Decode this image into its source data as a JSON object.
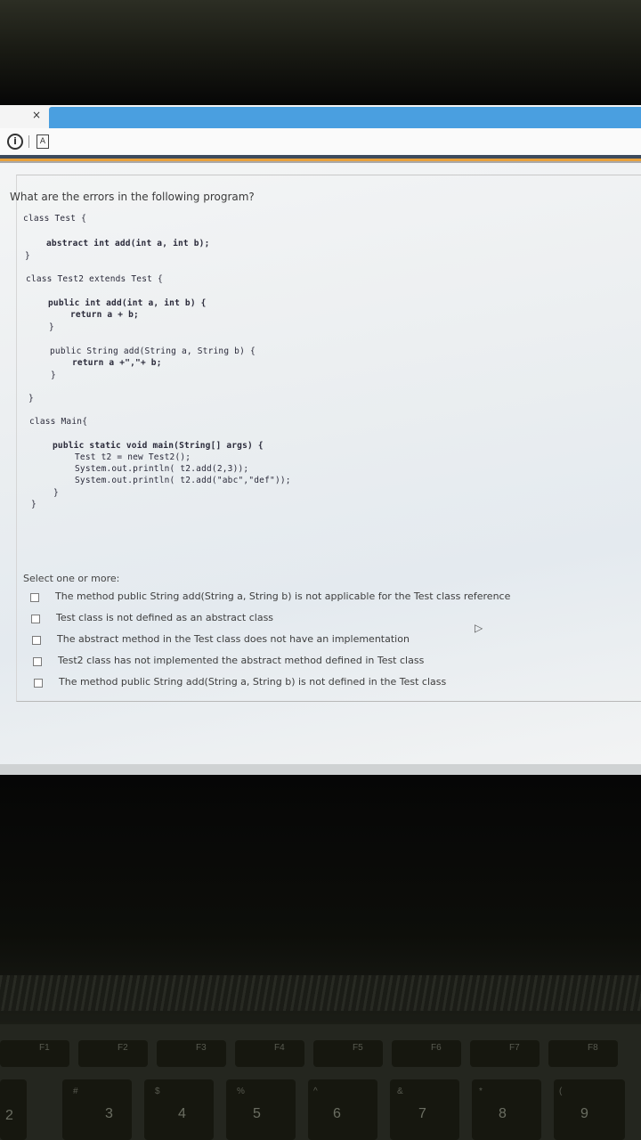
{
  "browser": {
    "tab_close": "×",
    "icons": [
      "info-icon",
      "page-icon"
    ]
  },
  "question": {
    "prompt": "What are the errors in the following program?",
    "code_lines": [
      "class Test {",
      "abstract int add(int a, int b);",
      "}",
      "class Test2 extends Test {",
      "public int add(int a, int b) {",
      "return a + b;",
      "}",
      "public String add(String a, String b) {",
      "return a +\",\"+ b;",
      "}",
      "}",
      "class Main{",
      "public static void main(String[] args) {",
      "Test t2 = new Test2();",
      "System.out.println( t2.add(2,3));",
      "System.out.println( t2.add(\"abc\",\"def\"));",
      "}",
      "}"
    ]
  },
  "answer": {
    "select_label": "Select one or more:",
    "options": [
      "The method public String add(String a, String b) is not applicable for the Test class reference",
      "Test class is not defined as an abstract class",
      "The abstract method in the Test class does not have an implementation",
      "Test2 class has not implemented the abstract method defined in Test class",
      "The method public String add(String a, String b) is not defined in the Test class"
    ]
  },
  "keyboard": {
    "fn_keys": [
      "F1",
      "F2",
      "F3",
      "F4",
      "F5",
      "F6",
      "F7",
      "F8"
    ],
    "number_keys": [
      "2",
      "3",
      "4",
      "5",
      "6",
      "7",
      "8",
      "9"
    ],
    "symbol_keys": [
      "#",
      "$",
      "%",
      "^",
      "&",
      "*",
      "("
    ]
  }
}
